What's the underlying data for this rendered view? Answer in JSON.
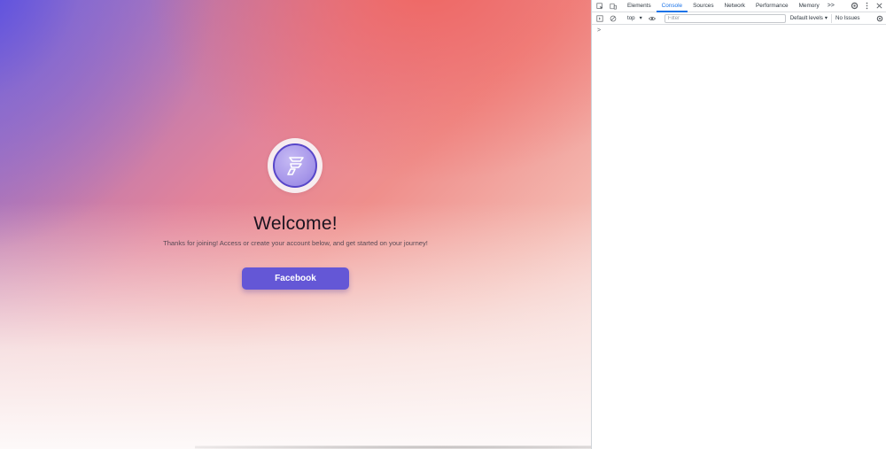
{
  "page": {
    "title": "Welcome!",
    "subtitle": "Thanks for joining! Access or create your account below, and get started on your journey!",
    "button_label": "Facebook"
  },
  "devtools": {
    "tabs": [
      {
        "label": "Elements"
      },
      {
        "label": "Console"
      },
      {
        "label": "Sources"
      },
      {
        "label": "Network"
      },
      {
        "label": "Performance"
      },
      {
        "label": "Memory"
      }
    ],
    "more_tabs": ">>",
    "active_tab": "Console",
    "toolbar": {
      "context": "top",
      "filter_placeholder": "Filter",
      "levels": "Default levels",
      "issues": "No Issues"
    },
    "prompt": ">"
  },
  "colors": {
    "accent": "#1a73e8",
    "button": "#6457d6"
  }
}
